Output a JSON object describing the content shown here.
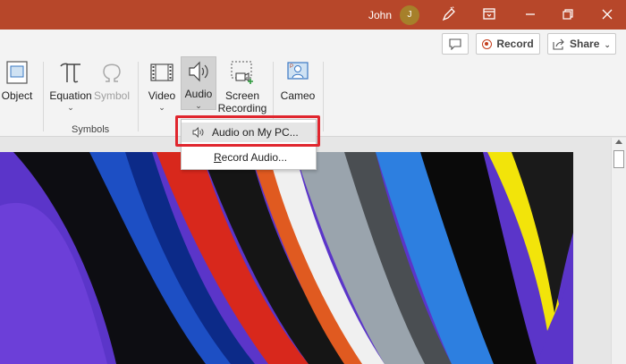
{
  "titlebar": {
    "user_name": "John",
    "avatar_initial": "J",
    "bg_color": "#b7472a"
  },
  "ribbon": {
    "record_label": "Record",
    "share_label": "Share",
    "buttons": {
      "object": "Object",
      "equation": "Equation",
      "symbol": "Symbol",
      "video": "Video",
      "audio": "Audio",
      "screen_recording_1": "Screen",
      "screen_recording_2": "Recording",
      "cameo": "Cameo"
    },
    "groups": {
      "symbols": "Symbols"
    }
  },
  "audio_menu": {
    "item_pc": "Audio on My PC...",
    "item_record_prefix": "R",
    "item_record_rest": "ecord Audio...",
    "highlight_color": "#e0262e"
  }
}
